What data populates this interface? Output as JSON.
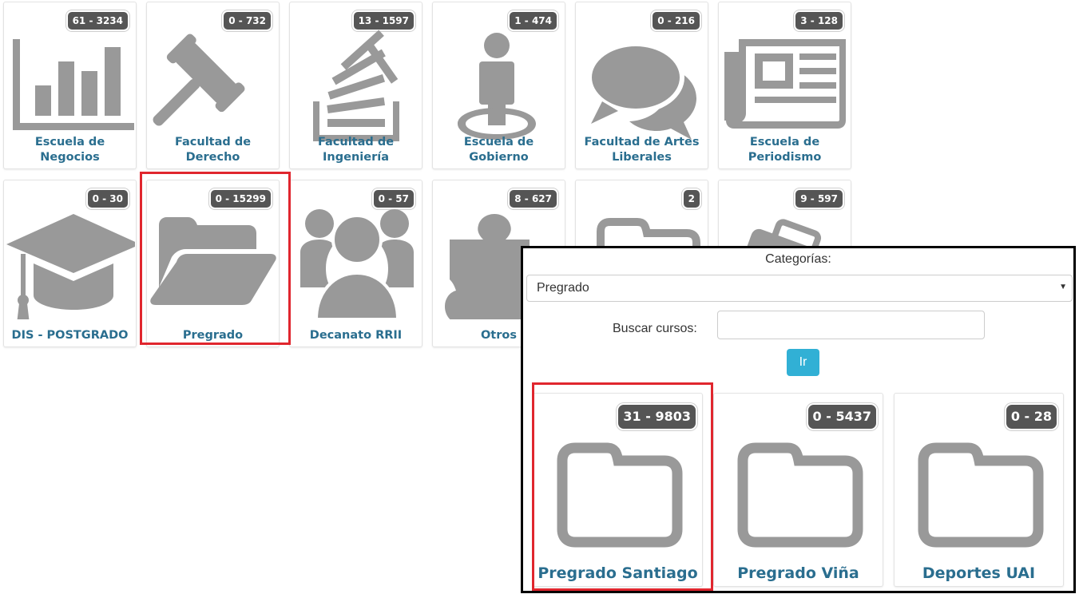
{
  "colors": {
    "icon_gray": "#999999",
    "label_blue": "#2a6e8f",
    "badge_bg": "#555555",
    "highlight_red": "#e0262e",
    "button_blue": "#31b0d5"
  },
  "categories": [
    {
      "badge": "61 - 3234",
      "label1": "Escuela de",
      "label2": "Negocios",
      "icon": "bar-chart-icon"
    },
    {
      "badge": "0 - 732",
      "label1": "Facultad de",
      "label2": "Derecho",
      "icon": "gavel-icon"
    },
    {
      "badge": "13 - 1597",
      "label1": "Facultad de",
      "label2": "Ingeniería",
      "icon": "stack-overflow-icon"
    },
    {
      "badge": "1 - 474",
      "label1": "Escuela de",
      "label2": "Gobierno",
      "icon": "street-view-icon"
    },
    {
      "badge": "0 - 216",
      "label1": "Facultad de Artes",
      "label2": "Liberales",
      "icon": "comments-icon"
    },
    {
      "badge": "3 - 128",
      "label1": "Escuela de",
      "label2": "Periodismo",
      "icon": "newspaper-icon"
    },
    {
      "badge": "0 - 30",
      "label1": "DIS - POSTGRADO",
      "label2": "",
      "icon": "graduation-cap-icon"
    },
    {
      "badge": "0 - 15299",
      "label1": "Pregrado",
      "label2": "",
      "icon": "folder-open-icon"
    },
    {
      "badge": "0 - 57",
      "label1": "Decanato RRII",
      "label2": "",
      "icon": "users-icon"
    },
    {
      "badge": "8 - 627",
      "label1": "Otros",
      "label2": "",
      "icon": "puzzle-piece-icon"
    },
    {
      "badge": "2",
      "label1": "",
      "label2": "",
      "icon": "folder-icon"
    },
    {
      "badge": "9 - 597",
      "label1": "",
      "label2": "",
      "icon": "briefcase-icon"
    }
  ],
  "panel": {
    "categories_label": "Categorías:",
    "selected_category": "Pregrado",
    "search_label": "Buscar cursos:",
    "search_value": "",
    "go_label": "Ir",
    "subcategories": [
      {
        "badge": "31 - 9803",
        "label": "Pregrado Santiago",
        "icon": "folder-icon"
      },
      {
        "badge": "0 - 5437",
        "label": "Pregrado Viña",
        "icon": "folder-icon"
      },
      {
        "badge": "0 - 28",
        "label": "Deportes UAI",
        "icon": "folder-icon"
      }
    ]
  }
}
